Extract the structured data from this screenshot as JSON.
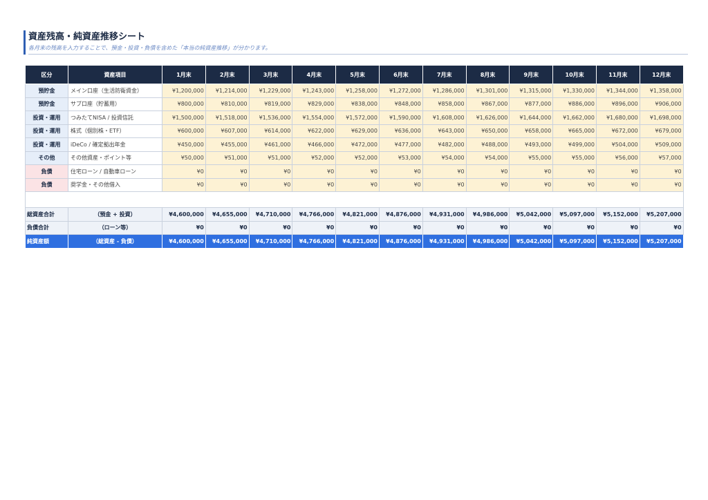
{
  "header": {
    "title": "資産残高・純資産推移シート",
    "subtitle": "各月末の残高を入力することで、預金・投資・負債を含めた「本当の純資産推移」が分かります。"
  },
  "table": {
    "col_category": "区分",
    "col_item": "資産項目",
    "months": [
      "1月末",
      "2月末",
      "3月末",
      "4月末",
      "5月末",
      "6月末",
      "7月末",
      "8月末",
      "9月末",
      "10月末",
      "11月末",
      "12月末"
    ],
    "rows": [
      {
        "category": "預貯金",
        "kind": "asset",
        "item": "メイン口座（生活防衛資金）",
        "values": [
          "¥1,200,000",
          "¥1,214,000",
          "¥1,229,000",
          "¥1,243,000",
          "¥1,258,000",
          "¥1,272,000",
          "¥1,286,000",
          "¥1,301,000",
          "¥1,315,000",
          "¥1,330,000",
          "¥1,344,000",
          "¥1,358,000"
        ]
      },
      {
        "category": "預貯金",
        "kind": "asset",
        "item": "サブ口座（貯蓄用）",
        "values": [
          "¥800,000",
          "¥810,000",
          "¥819,000",
          "¥829,000",
          "¥838,000",
          "¥848,000",
          "¥858,000",
          "¥867,000",
          "¥877,000",
          "¥886,000",
          "¥896,000",
          "¥906,000"
        ]
      },
      {
        "category": "投資・運用",
        "kind": "asset",
        "item": "つみたてNISA / 投資信託",
        "values": [
          "¥1,500,000",
          "¥1,518,000",
          "¥1,536,000",
          "¥1,554,000",
          "¥1,572,000",
          "¥1,590,000",
          "¥1,608,000",
          "¥1,626,000",
          "¥1,644,000",
          "¥1,662,000",
          "¥1,680,000",
          "¥1,698,000"
        ]
      },
      {
        "category": "投資・運用",
        "kind": "asset",
        "item": "株式（個別株・ETF）",
        "values": [
          "¥600,000",
          "¥607,000",
          "¥614,000",
          "¥622,000",
          "¥629,000",
          "¥636,000",
          "¥643,000",
          "¥650,000",
          "¥658,000",
          "¥665,000",
          "¥672,000",
          "¥679,000"
        ]
      },
      {
        "category": "投資・運用",
        "kind": "asset",
        "item": "iDeCo / 確定拠出年金",
        "values": [
          "¥450,000",
          "¥455,000",
          "¥461,000",
          "¥466,000",
          "¥472,000",
          "¥477,000",
          "¥482,000",
          "¥488,000",
          "¥493,000",
          "¥499,000",
          "¥504,000",
          "¥509,000"
        ]
      },
      {
        "category": "その他",
        "kind": "asset",
        "item": "その他資産・ポイント等",
        "values": [
          "¥50,000",
          "¥51,000",
          "¥51,000",
          "¥52,000",
          "¥52,000",
          "¥53,000",
          "¥54,000",
          "¥54,000",
          "¥55,000",
          "¥55,000",
          "¥56,000",
          "¥57,000"
        ]
      },
      {
        "category": "負債",
        "kind": "debt",
        "item": "住宅ローン / 自動車ローン",
        "values": [
          "¥0",
          "¥0",
          "¥0",
          "¥0",
          "¥0",
          "¥0",
          "¥0",
          "¥0",
          "¥0",
          "¥0",
          "¥0",
          "¥0"
        ]
      },
      {
        "category": "負債",
        "kind": "debt",
        "item": "奨学金・その他借入",
        "values": [
          "¥0",
          "¥0",
          "¥0",
          "¥0",
          "¥0",
          "¥0",
          "¥0",
          "¥0",
          "¥0",
          "¥0",
          "¥0",
          "¥0"
        ]
      }
    ],
    "summary": [
      {
        "label": "総資産合計",
        "note": "（預金 + 投資）",
        "style": "sum",
        "values": [
          "¥4,600,000",
          "¥4,655,000",
          "¥4,710,000",
          "¥4,766,000",
          "¥4,821,000",
          "¥4,876,000",
          "¥4,931,000",
          "¥4,986,000",
          "¥5,042,000",
          "¥5,097,000",
          "¥5,152,000",
          "¥5,207,000"
        ]
      },
      {
        "label": "負債合計",
        "note": "（ローン等）",
        "style": "sum",
        "values": [
          "¥0",
          "¥0",
          "¥0",
          "¥0",
          "¥0",
          "¥0",
          "¥0",
          "¥0",
          "¥0",
          "¥0",
          "¥0",
          "¥0"
        ]
      },
      {
        "label": "純資産額",
        "note": "（総資産 - 負債）",
        "style": "net",
        "values": [
          "¥4,600,000",
          "¥4,655,000",
          "¥4,710,000",
          "¥4,766,000",
          "¥4,821,000",
          "¥4,876,000",
          "¥4,931,000",
          "¥4,986,000",
          "¥5,042,000",
          "¥5,097,000",
          "¥5,152,000",
          "¥5,207,000"
        ]
      }
    ]
  },
  "colors": {
    "header_bg": "#1c2b45",
    "accent_blue": "#2f6fe0",
    "input_cell_bg": "#fdf2d4",
    "asset_category_bg": "#e6eef9",
    "debt_category_bg": "#fbe3e5"
  }
}
